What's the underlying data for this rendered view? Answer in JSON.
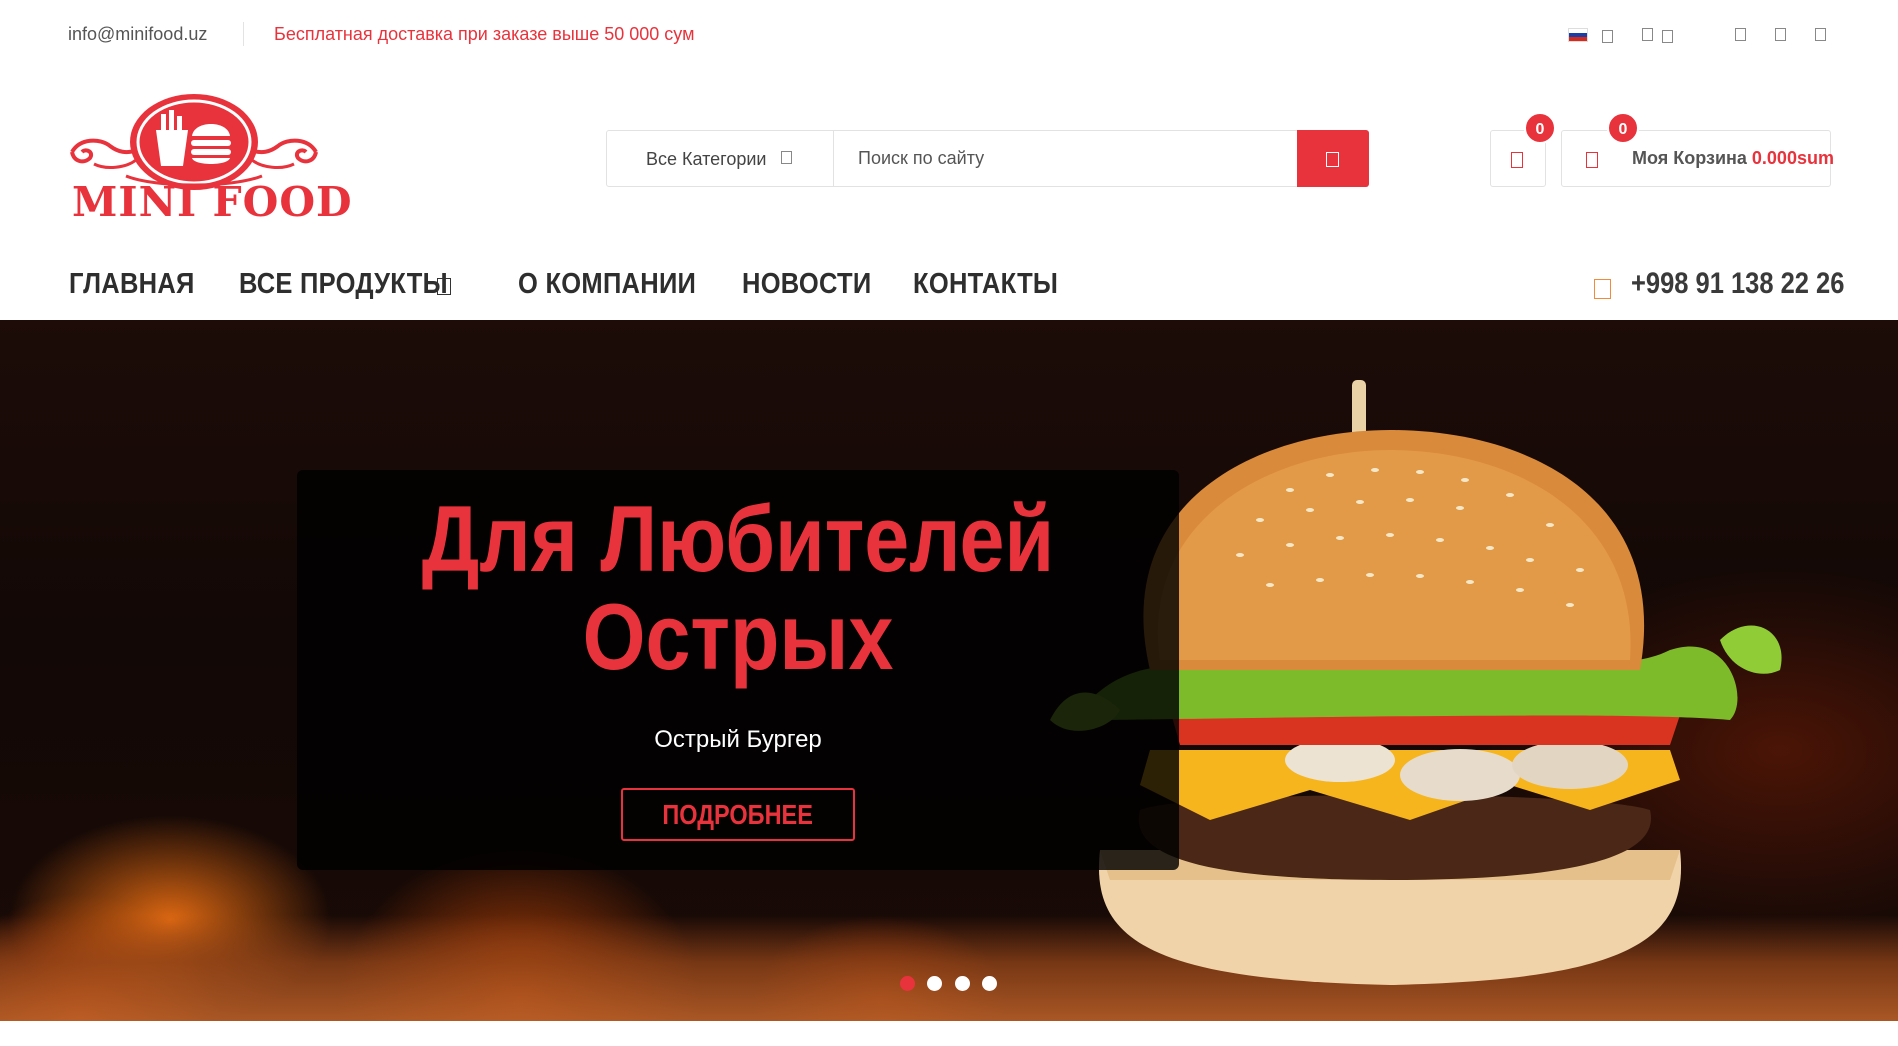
{
  "topbar": {
    "email": "info@minifood.uz",
    "promo": "Бесплатная доставка при заказе выше 50 000 сум",
    "language_flag_icon": "russia-flag-icon"
  },
  "logo": {
    "text": "MINI FOOD"
  },
  "search": {
    "category_label": "Все Категории",
    "placeholder": "Поиск по сайту",
    "button_icon": "search-icon"
  },
  "wishlist": {
    "count": "0"
  },
  "cart": {
    "label": "Моя Корзина",
    "total": "0.000sum",
    "count": "0"
  },
  "nav": {
    "items": [
      {
        "label": "ГЛАВНАЯ"
      },
      {
        "label": "ВСЕ ПРОДУКТЫ"
      },
      {
        "label": "О КОМПАНИИ"
      },
      {
        "label": "НОВОСТИ"
      },
      {
        "label": "КОНТАКТЫ"
      }
    ],
    "phone": "+998 91 138 22 26"
  },
  "hero": {
    "title_line1": "Для Любителей",
    "title_line2": "Острых",
    "subtitle": "Острый Бургер",
    "button_label": "ПОДРОБНЕЕ",
    "slide_count": 4,
    "active_slide": 1
  },
  "colors": {
    "accent": "#e8333c",
    "phone_icon": "#f08a3c",
    "nav_text": "#2e2e2e"
  }
}
